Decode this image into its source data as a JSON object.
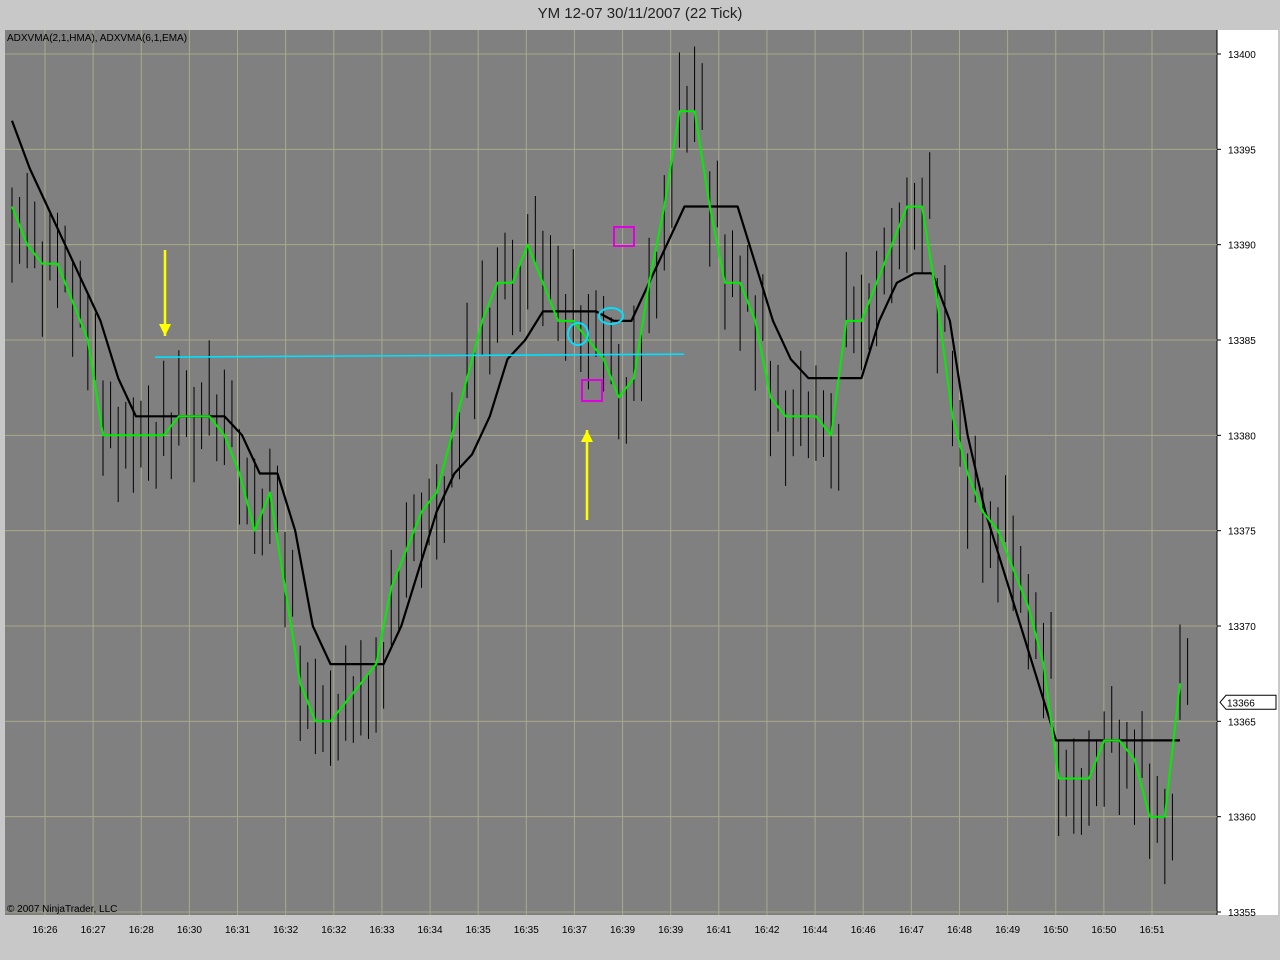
{
  "window": {
    "title": "YM 12-07  30/11/2007  (22 Tick)"
  },
  "indicator_label": "ADXVMA(2,1,HMA), ADXVMA(6,1,EMA)",
  "copyright": "© 2007 NinjaTrader, LLC",
  "colors": {
    "background": "#808080",
    "grid": "#a9a98a",
    "bars": "#000000",
    "fast_ma": "#00ee00",
    "slow_ma": "#000000",
    "level_line": "#00e0ff",
    "arrow": "#ffff00",
    "square_marker": "#e000e0",
    "circle_marker": "#00e0ff"
  },
  "chart_data": {
    "type": "line",
    "symbol": "YM 12-07",
    "ylim": [
      13355,
      13402
    ],
    "y_ticks": [
      13355,
      13360,
      13365,
      13370,
      13375,
      13380,
      13385,
      13390,
      13395,
      13400
    ],
    "x_tick_labels": [
      "16:26",
      "16:27",
      "16:28",
      "16:30",
      "16:31",
      "16:32",
      "16:32",
      "16:33",
      "16:34",
      "16:35",
      "16:35",
      "16:37",
      "16:39",
      "16:39",
      "16:41",
      "16:42",
      "16:44",
      "16:46",
      "16:47",
      "16:48",
      "16:49",
      "16:50",
      "16:50",
      "16:51"
    ],
    "last_price": 13366,
    "last_price_label": "13366",
    "series": [
      {
        "indicator": "ADXVMA(2,1,HMA)",
        "color": "#00ee00",
        "values": [
          13392,
          13390,
          13389,
          13389,
          13387,
          13385,
          13380,
          13380,
          13380,
          13380,
          13380,
          13381,
          13381,
          13381,
          13380,
          13378,
          13375,
          13377,
          13372,
          13367,
          13365,
          13365,
          13366,
          13367,
          13368,
          13372,
          13374,
          13376,
          13377,
          13380,
          13383,
          13386,
          13388,
          13388,
          13390,
          13388,
          13386,
          13386,
          13385,
          13384,
          13382,
          13383,
          13388,
          13392,
          13397,
          13397,
          13392,
          13388,
          13388,
          13386,
          13382,
          13381,
          13381,
          13381,
          13380,
          13386,
          13386,
          13388,
          13390,
          13392,
          13392,
          13387,
          13381,
          13378,
          13376,
          13375,
          13373,
          13371,
          13368,
          13362,
          13362,
          13362,
          13364,
          13364,
          13363,
          13360,
          13360,
          13367
        ]
      },
      {
        "indicator": "ADXVMA(6,1,EMA)",
        "color": "#000000",
        "values": [
          13396.5,
          13394,
          13392,
          13390,
          13388,
          13386,
          13383,
          13381,
          13381,
          13381,
          13381,
          13381,
          13381,
          13380,
          13378,
          13378,
          13375,
          13370,
          13368,
          13368,
          13368,
          13368,
          13370,
          13373,
          13376,
          13378,
          13379,
          13381,
          13384,
          13385,
          13386.5,
          13386.5,
          13386.5,
          13386.5,
          13386,
          13386,
          13388,
          13390,
          13392,
          13392,
          13392,
          13392,
          13389,
          13386,
          13384,
          13383,
          13383,
          13383,
          13383,
          13386,
          13388,
          13388.5,
          13388.5,
          13386,
          13380,
          13376,
          13373,
          13370,
          13367,
          13364,
          13364,
          13364,
          13364,
          13364,
          13364,
          13364,
          13364
        ]
      }
    ],
    "annotations": {
      "horizontal_level": 13384.1
    }
  }
}
